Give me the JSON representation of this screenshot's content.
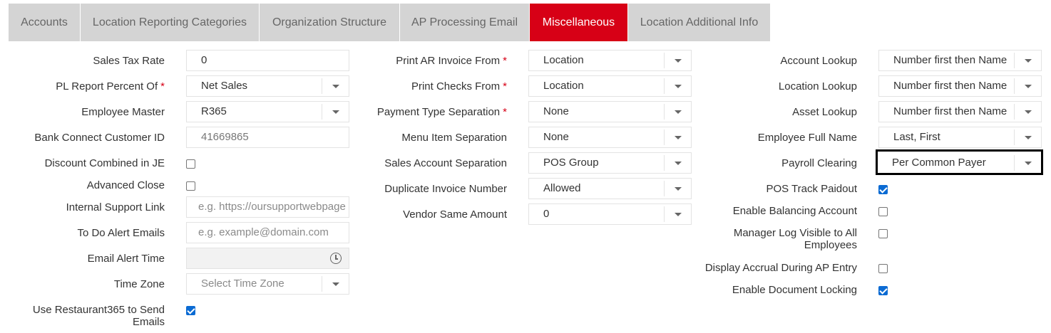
{
  "tabs": [
    {
      "label": "Accounts",
      "active": false
    },
    {
      "label": "Location Reporting Categories",
      "active": false
    },
    {
      "label": "Organization Structure",
      "active": false
    },
    {
      "label": "AP Processing Email",
      "active": false
    },
    {
      "label": "Miscellaneous",
      "active": true
    },
    {
      "label": "Location Additional Info",
      "active": false
    }
  ],
  "col1": {
    "sales_tax_rate": {
      "label": "Sales Tax Rate",
      "value": "0"
    },
    "pl_report": {
      "label": "PL Report Percent Of",
      "required": "*",
      "value": "Net Sales"
    },
    "employee_master": {
      "label": "Employee Master",
      "value": "R365"
    },
    "bank_connect": {
      "label": "Bank Connect Customer ID",
      "value": "41669865"
    },
    "discount_combined": {
      "label": "Discount Combined in JE",
      "checked": false
    },
    "advanced_close": {
      "label": "Advanced Close",
      "checked": false
    },
    "internal_support": {
      "label": "Internal Support Link",
      "placeholder": "e.g. https://oursupportwebpage"
    },
    "todo_alert": {
      "label": "To Do Alert Emails",
      "placeholder": "e.g. example@domain.com"
    },
    "email_alert_time": {
      "label": "Email Alert Time",
      "value": ""
    },
    "time_zone": {
      "label": "Time Zone",
      "placeholder": "Select Time Zone"
    },
    "use_r365": {
      "label": "Use Restaurant365 to Send Emails",
      "checked": true
    }
  },
  "col2": {
    "print_ar": {
      "label": "Print AR Invoice From",
      "required": "*",
      "value": "Location"
    },
    "print_checks": {
      "label": "Print Checks From",
      "required": "*",
      "value": "Location"
    },
    "payment_type": {
      "label": "Payment Type Separation",
      "required": "*",
      "value": "None"
    },
    "menu_item": {
      "label": "Menu Item Separation",
      "value": "None"
    },
    "sales_account": {
      "label": "Sales Account Separation",
      "value": "POS Group"
    },
    "duplicate_invoice": {
      "label": "Duplicate Invoice Number",
      "value": "Allowed"
    },
    "vendor_same": {
      "label": "Vendor Same Amount",
      "value": "0"
    }
  },
  "col3": {
    "account_lookup": {
      "label": "Account Lookup",
      "value": "Number first then Name"
    },
    "location_lookup": {
      "label": "Location Lookup",
      "value": "Number first then Name"
    },
    "asset_lookup": {
      "label": "Asset Lookup",
      "value": "Number first then Name"
    },
    "employee_full_name": {
      "label": "Employee Full Name",
      "value": "Last, First"
    },
    "payroll_clearing": {
      "label": "Payroll Clearing",
      "value": "Per Common Payer"
    },
    "pos_track": {
      "label": "POS Track Paidout",
      "checked": true
    },
    "balancing_account": {
      "label": "Enable Balancing Account",
      "checked": false
    },
    "manager_log": {
      "label": "Manager Log Visible to All Employees",
      "checked": false
    },
    "display_accrual": {
      "label": "Display Accrual During AP Entry",
      "checked": false
    },
    "document_locking": {
      "label": "Enable Document Locking",
      "checked": true
    }
  },
  "colors": {
    "accent": "#d70016",
    "tab_bg": "#d4d4d4",
    "checkbox_on": "#0b6bd3",
    "highlight_border": "#000000"
  }
}
